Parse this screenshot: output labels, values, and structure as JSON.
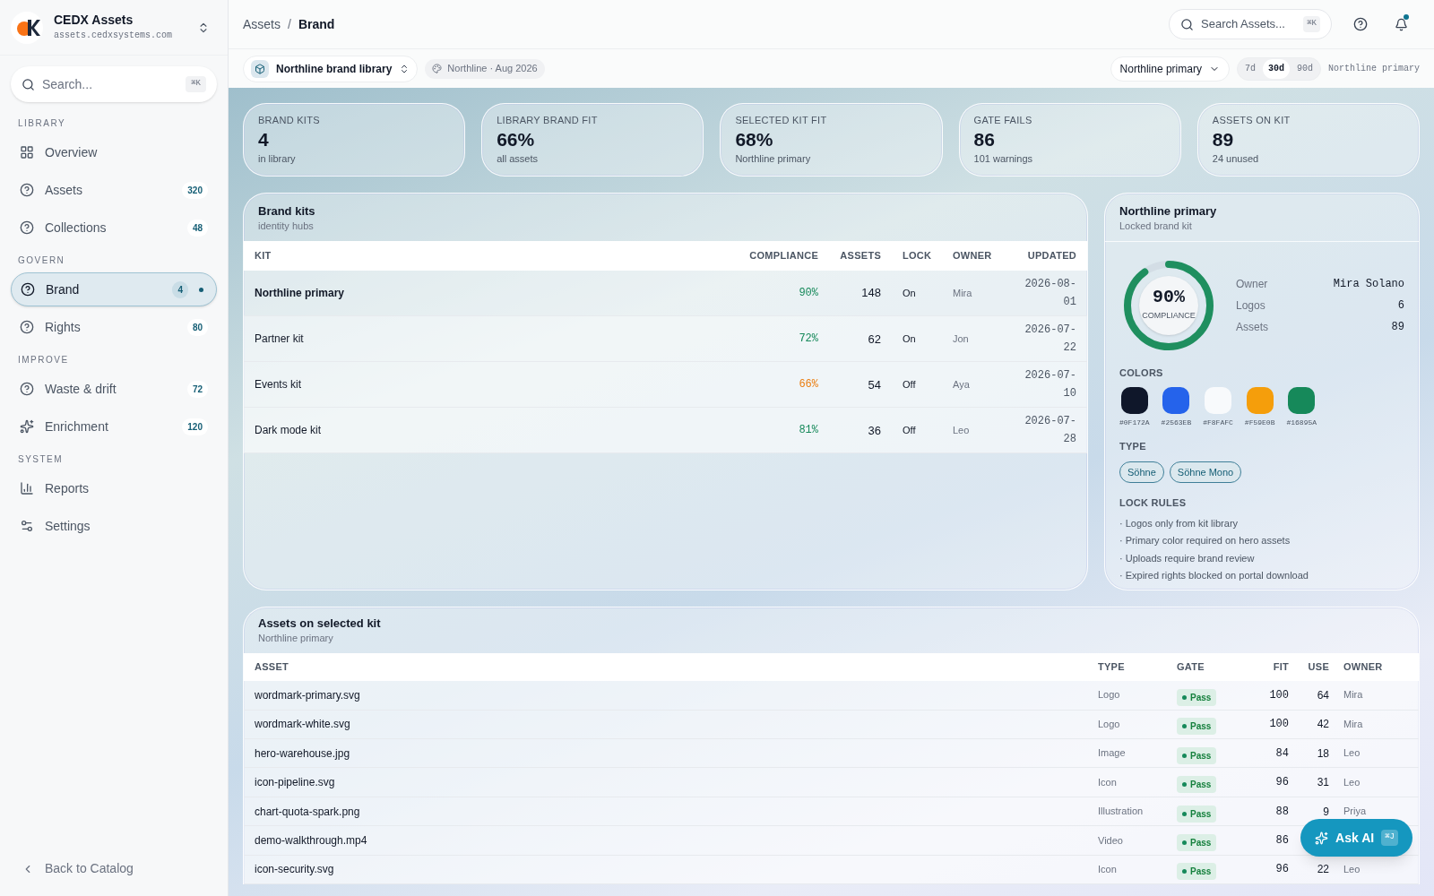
{
  "sidebar": {
    "brand": {
      "name": "CEDX Assets",
      "domain": "assets.cedxsystems.com"
    },
    "search": {
      "placeholder": "Search...",
      "shortcut": "⌘K"
    },
    "sections": [
      {
        "title": "LIBRARY",
        "items": [
          {
            "label": "Overview",
            "selected": false,
            "dot": false
          },
          {
            "label": "Assets",
            "count": "320",
            "selected": false,
            "dot": false
          },
          {
            "label": "Collections",
            "count": "48",
            "selected": false,
            "dot": false
          }
        ]
      },
      {
        "title": "GOVERN",
        "items": [
          {
            "label": "Brand",
            "count": "4",
            "selected": true,
            "dot": true
          },
          {
            "label": "Rights",
            "count": "80",
            "selected": false,
            "dot": false
          }
        ]
      },
      {
        "title": "IMPROVE",
        "items": [
          {
            "label": "Waste & drift",
            "count": "72",
            "selected": false,
            "dot": false
          },
          {
            "label": "Enrichment",
            "count": "120",
            "selected": false,
            "dot": false
          }
        ]
      },
      {
        "title": "SYSTEM",
        "items": [
          {
            "label": "Reports",
            "selected": false,
            "dot": false
          },
          {
            "label": "Settings",
            "selected": false,
            "dot": false
          }
        ]
      }
    ],
    "back": "Back to Catalog"
  },
  "header": {
    "breadcrumb": [
      "Assets",
      "Brand"
    ],
    "separator": "/",
    "search": {
      "placeholder": "Search Assets...",
      "shortcut": "⌘K"
    },
    "unread": true
  },
  "toolbar": {
    "library": "Northline brand library",
    "tag": "Northline · Aug 2026",
    "kit_select": "Northline primary",
    "ranges": [
      {
        "label": "7d",
        "selected": false
      },
      {
        "label": "30d",
        "selected": true
      },
      {
        "label": "90d",
        "selected": false
      }
    ],
    "range_note": "Northline primary"
  },
  "stats": [
    {
      "label": "BRAND KITS",
      "value": "4",
      "note": "in library"
    },
    {
      "label": "LIBRARY BRAND FIT",
      "value": "66%",
      "note": "all assets"
    },
    {
      "label": "SELECTED KIT FIT",
      "value": "68%",
      "note": "Northline primary"
    },
    {
      "label": "GATE FAILS",
      "value": "86",
      "note": "101 warnings"
    },
    {
      "label": "ASSETS ON KIT",
      "value": "89",
      "note": "24 unused"
    }
  ],
  "kits": {
    "title": "Brand kits",
    "subtitle": "identity hubs",
    "columns": [
      "KIT",
      "COMPLIANCE",
      "ASSETS",
      "LOCK",
      "OWNER",
      "UPDATED"
    ],
    "rows": [
      {
        "kit": "Northline primary",
        "compliance": "90%",
        "color": "#16895a",
        "assets": "148",
        "lock": "On",
        "owner": "Mira",
        "updated": "2026-08-01",
        "selected": true
      },
      {
        "kit": "Partner kit",
        "compliance": "72%",
        "color": "#16895a",
        "assets": "62",
        "lock": "On",
        "owner": "Jon",
        "updated": "2026-07-22",
        "selected": false
      },
      {
        "kit": "Events kit",
        "compliance": "66%",
        "color": "#ea7c0e",
        "assets": "54",
        "lock": "Off",
        "owner": "Aya",
        "updated": "2026-07-10",
        "selected": false
      },
      {
        "kit": "Dark mode kit",
        "compliance": "81%",
        "color": "#16895a",
        "assets": "36",
        "lock": "Off",
        "owner": "Leo",
        "updated": "2026-07-28",
        "selected": false
      }
    ]
  },
  "detail": {
    "title": "Northline primary",
    "subtitle": "Locked brand kit",
    "ring": {
      "level": 0.9,
      "value": "90%",
      "label": "COMPLIANCE"
    },
    "facts": [
      {
        "label": "Owner",
        "value": "Mira Solano"
      },
      {
        "label": "Logos",
        "value": "6"
      },
      {
        "label": "Assets",
        "value": "89"
      }
    ],
    "colors_title": "COLORS",
    "colors": [
      {
        "color": "#0f172a",
        "code": "#0F172A"
      },
      {
        "color": "#2563eb",
        "code": "#2563EB"
      },
      {
        "color": "#f8fafc",
        "code": "#F8FAFC"
      },
      {
        "color": "#f59e0b",
        "code": "#F59E0B"
      },
      {
        "color": "#16895a",
        "code": "#16895A"
      }
    ],
    "type_title": "TYPE",
    "fonts": [
      "Söhne",
      "Söhne Mono"
    ],
    "rules_title": "LOCK RULES",
    "rules": [
      "· Logos only from kit library",
      "· Primary color required on hero assets",
      "· Uploads require brand review",
      "· Expired rights blocked on portal download"
    ]
  },
  "assets": {
    "title": "Assets on selected kit",
    "subtitle": "Northline primary",
    "columns": [
      "ASSET",
      "TYPE",
      "GATE",
      "FIT",
      "USE",
      "OWNER"
    ],
    "rows": [
      {
        "asset": "wordmark-primary.svg",
        "type": "Logo",
        "gate": "Pass",
        "fit": "100",
        "use": "64",
        "owner": "Mira"
      },
      {
        "asset": "wordmark-white.svg",
        "type": "Logo",
        "gate": "Pass",
        "fit": "100",
        "use": "42",
        "owner": "Mira"
      },
      {
        "asset": "hero-warehouse.jpg",
        "type": "Image",
        "gate": "Pass",
        "fit": "84",
        "use": "18",
        "owner": "Leo"
      },
      {
        "asset": "icon-pipeline.svg",
        "type": "Icon",
        "gate": "Pass",
        "fit": "96",
        "use": "31",
        "owner": "Leo"
      },
      {
        "asset": "chart-quota-spark.png",
        "type": "Illustration",
        "gate": "Pass",
        "fit": "88",
        "use": "9",
        "owner": "Priya"
      },
      {
        "asset": "demo-walkthrough.mp4",
        "type": "Video",
        "gate": "Pass",
        "fit": "86"
      },
      {
        "asset": "icon-security.svg",
        "type": "Icon",
        "gate": "Pass",
        "fit": "96",
        "use": "22",
        "owner": "Leo"
      }
    ]
  },
  "ask": {
    "label": "Ask AI",
    "shortcut": "⌘J"
  }
}
